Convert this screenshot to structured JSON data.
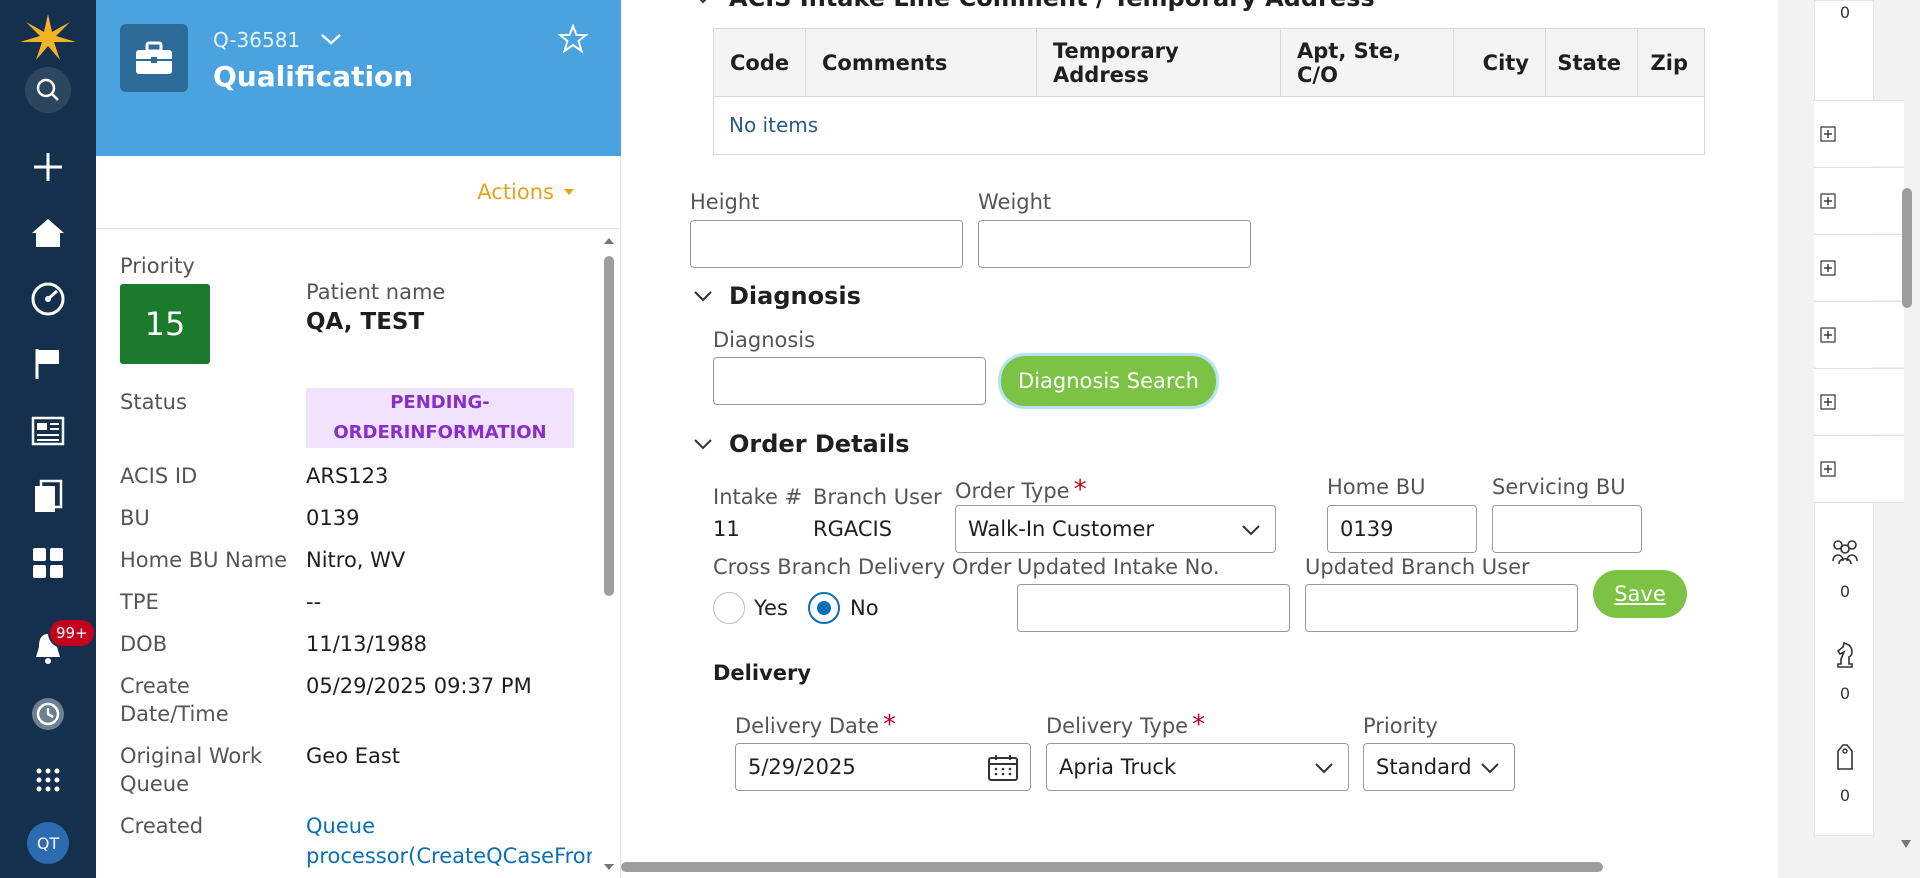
{
  "nav": {
    "badge": "99+",
    "avatar": "QT",
    "icons": [
      "logo-icon",
      "search-icon",
      "plus-icon",
      "home-icon",
      "dashboard-icon",
      "flag-icon",
      "news-icon",
      "documents-icon",
      "apps-grid-icon",
      "bell-icon",
      "history-icon",
      "more-apps-icon"
    ]
  },
  "case": {
    "id": "Q-36581",
    "title": "Qualification",
    "actions_label": "Actions",
    "priority_label": "Priority",
    "priority_value": "15",
    "patient_label": "Patient name",
    "patient_value": "QA, TEST",
    "status_label": "Status",
    "status_value_line1": "PENDING-",
    "status_value_line2": "ORDERINFORMATION",
    "fields": [
      {
        "label": "ACIS ID",
        "value": "ARS123"
      },
      {
        "label": "BU",
        "value": "0139"
      },
      {
        "label": "Home BU Name",
        "value": "Nitro, WV"
      },
      {
        "label": "TPE",
        "value": "--"
      },
      {
        "label": "DOB",
        "value": "11/13/1988"
      }
    ],
    "create_label_1": "Create",
    "create_label_2": "Date/Time",
    "create_value": "05/29/2025 09:37 PM",
    "owq_label_1": "Original Work",
    "owq_label_2": "Queue",
    "owq_value": "Geo East",
    "created_label": "Created",
    "created_value_1": "Queue",
    "created_value_2": "processor(CreateQCaseFromIi"
  },
  "main": {
    "acis_section_title": "ACIS Intake Line Comment / Temporary Address",
    "table": {
      "columns": [
        "Code",
        "Comments",
        "Temporary Address",
        "Apt, Ste, C/O",
        "City",
        "State",
        "Zip"
      ],
      "empty_text": "No items"
    },
    "height_label": "Height",
    "weight_label": "Weight",
    "height_value": "",
    "weight_value": "",
    "diagnosis_section_title": "Diagnosis",
    "diagnosis_label": "Diagnosis",
    "diagnosis_value": "",
    "diagnosis_search_label": "Diagnosis Search",
    "order_section_title": "Order Details",
    "intake_label": "Intake #",
    "intake_value": "11",
    "branch_user_label": "Branch User",
    "branch_user_value": "RGACIS",
    "order_type_label": "Order Type",
    "order_type_value": "Walk-In Customer",
    "home_bu_label": "Home BU",
    "home_bu_value": "0139",
    "servicing_bu_label": "Servicing BU",
    "servicing_bu_value": "",
    "cross_branch_label": "Cross Branch Delivery Order",
    "yes_label": "Yes",
    "no_label": "No",
    "cross_branch_selected": "No",
    "updated_intake_label": "Updated Intake No.",
    "updated_intake_value": "",
    "updated_branch_user_label": "Updated Branch User",
    "updated_branch_user_value": "",
    "save_label": "Save",
    "delivery_section_title": "Delivery",
    "delivery_date_label": "Delivery Date",
    "delivery_date_value": "5/29/2025",
    "delivery_type_label": "Delivery Type",
    "delivery_type_value": "Apria Truck",
    "priority_label": "Priority",
    "priority_value": "Standard"
  },
  "rail": {
    "counts": [
      "0",
      "0",
      "0",
      "0"
    ]
  },
  "colors": {
    "nav_bg": "#14304d",
    "case_header": "#4aa3df",
    "priority_green": "#1b7a2c",
    "status_bg": "#f0e3fb",
    "status_text": "#8a2dc9",
    "button_green": "#7cc244",
    "actions_orange": "#e8a21a",
    "required": "#c4001f",
    "link": "#0b6fb8"
  }
}
